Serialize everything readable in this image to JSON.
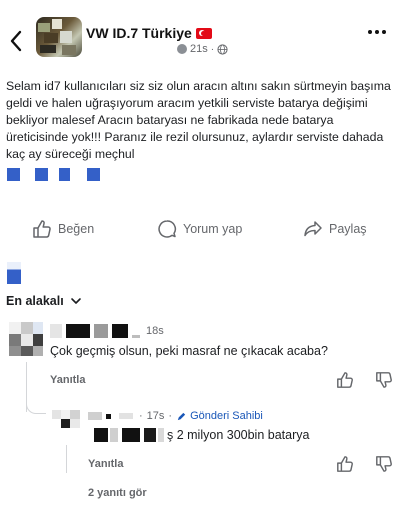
{
  "header": {
    "group_name": "VW ID.7 Türkiye",
    "time_ago": "21s"
  },
  "post": {
    "text": "Selam id7 kullanıcıları siz siz olun aracın altını sakın sürtmeyin başıma geldi ve halen uğraşıyorum aracım yetkili serviste batarya değişimi bekliyor malesef Aracın bataryası ne fabrikada nede batarya üreticisinde yok!!! Paranız ile rezil olursunuz, aylardır serviste dahada kaç ay süreceği meçhul"
  },
  "actions": {
    "like_label": "Beğen",
    "comment_label": "Yorum yap",
    "share_label": "Paylaş"
  },
  "comments": {
    "sort_label": "En alakalı",
    "first": {
      "time": "18s",
      "text": "Çok geçmiş olsun, peki masraf ne çıkacak acaba?",
      "reply_label": "Yanıtla"
    },
    "reply": {
      "time": "17s",
      "author_badge": "Gönderi Sahibi",
      "text": "ş 2 milyon 300bin batarya",
      "reply_label": "Yanıtla"
    },
    "see_replies_label": "2 yanıtı gör"
  },
  "colors": {
    "accent_blue": "#3460c8",
    "text_primary": "#1c1e21",
    "text_secondary": "#65676b",
    "author_badge": "#1a57b8"
  },
  "icons": [
    "chevron-left-icon",
    "globe-icon",
    "more-icon",
    "thumbs-up-icon",
    "comment-icon",
    "share-icon",
    "chevron-down-icon",
    "thumbs-down-icon",
    "pen-icon"
  ]
}
